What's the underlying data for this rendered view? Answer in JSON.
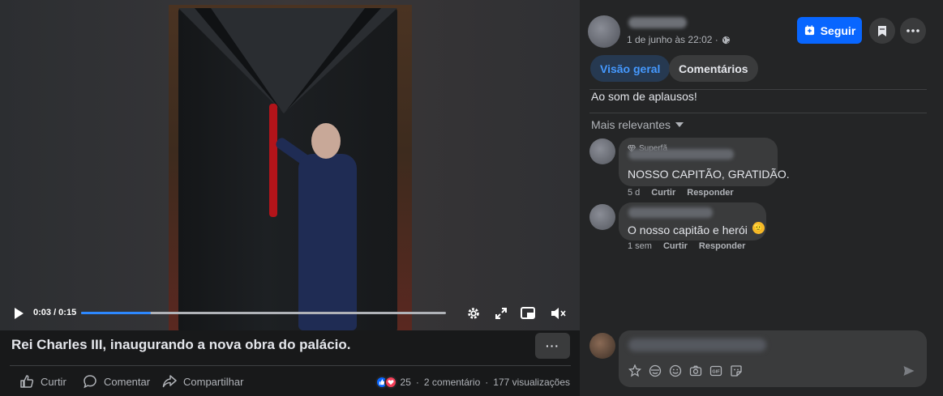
{
  "video": {
    "time": "0:03 / 0:15",
    "progress": 0.19
  },
  "post": {
    "title": "Rei Charles III, inaugurando a nova obra do palácio.",
    "more": "···",
    "date": "1 de junho às 22:02 ·",
    "caption": "Ao som de aplausos!"
  },
  "actions": {
    "like": "Curtir",
    "comment": "Comentar",
    "share": "Compartilhar"
  },
  "stats": {
    "reactions": "25",
    "sep1": "·",
    "comments": "2 comentário",
    "sep2": "·",
    "views": "177 visualizações"
  },
  "header": {
    "follow": "Seguir"
  },
  "tabs": [
    {
      "label": "Visão geral"
    },
    {
      "label": "Comentários"
    }
  ],
  "sort_label": "Mais relevantes",
  "comments": [
    {
      "badge": "Superfã",
      "text": "NOSSO CAPITÃO, GRATIDÃO.",
      "time": "5 d",
      "like": "Curtir",
      "reply": "Responder"
    },
    {
      "badge": "",
      "text": "O nosso capitão e herói",
      "emoji": "🫡",
      "time": "1 sem",
      "like": "Curtir",
      "reply": "Responder"
    }
  ],
  "colors": {
    "accent": "#0866ff",
    "tab_active_text": "#4599ff",
    "panel_bg": "#242526",
    "page_bg": "#18191a"
  },
  "icons": [
    "play-icon",
    "settings-icon",
    "expand-icon",
    "pip-icon",
    "mute-icon",
    "like-icon",
    "comment-icon",
    "share-icon",
    "globe-icon",
    "follow-icon",
    "save-icon",
    "more-icon",
    "caret-down-icon",
    "diamond-icon",
    "sticker-icon",
    "avatar-icon",
    "emoji-icon",
    "camera-icon",
    "gif-icon",
    "sticker2-icon",
    "send-icon"
  ]
}
